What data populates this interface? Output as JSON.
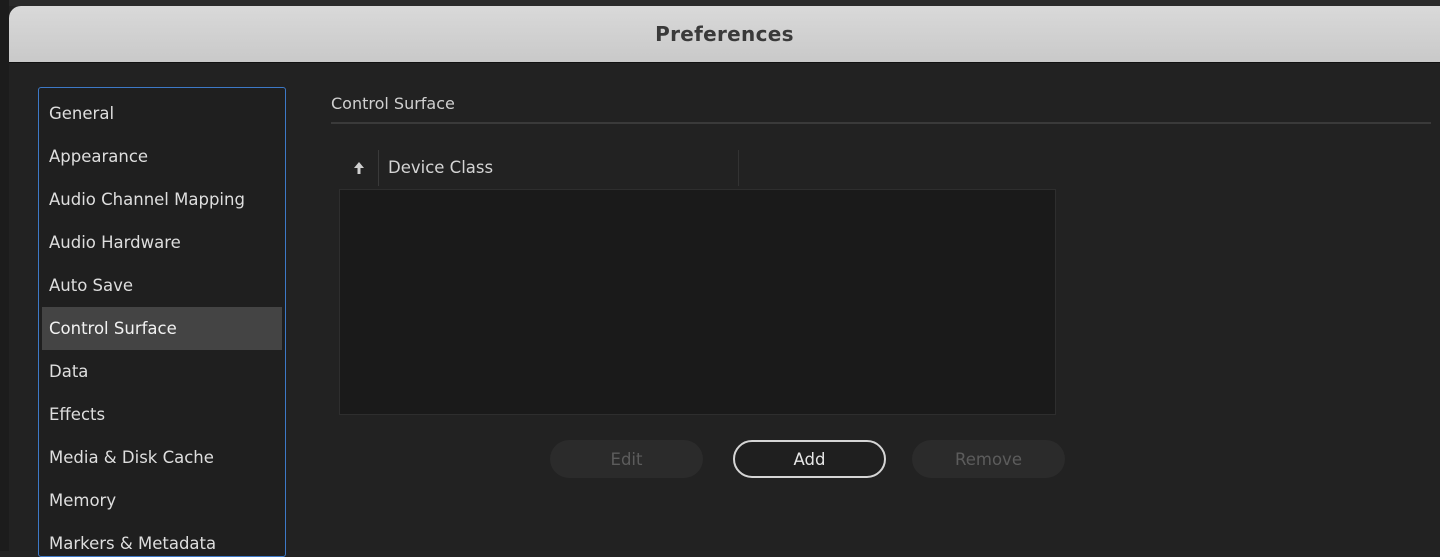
{
  "window": {
    "title": "Preferences"
  },
  "sidebar": {
    "items": [
      {
        "label": "General",
        "selected": false
      },
      {
        "label": "Appearance",
        "selected": false
      },
      {
        "label": "Audio Channel Mapping",
        "selected": false
      },
      {
        "label": "Audio Hardware",
        "selected": false
      },
      {
        "label": "Auto Save",
        "selected": false
      },
      {
        "label": "Control Surface",
        "selected": true
      },
      {
        "label": "Data",
        "selected": false
      },
      {
        "label": "Effects",
        "selected": false
      },
      {
        "label": "Media & Disk Cache",
        "selected": false
      },
      {
        "label": "Memory",
        "selected": false
      },
      {
        "label": "Markers & Metadata",
        "selected": false
      }
    ]
  },
  "panel": {
    "section_title": "Control Surface",
    "table": {
      "sort_icon": "arrow-up-icon",
      "column_header": "Device Class",
      "rows": []
    },
    "buttons": {
      "edit": {
        "label": "Edit",
        "enabled": false
      },
      "add": {
        "label": "Add",
        "enabled": true
      },
      "remove": {
        "label": "Remove",
        "enabled": false
      }
    }
  },
  "colors": {
    "selection": "#444444",
    "focus_border": "#3d79c7",
    "titlebar": "#d0d0d0"
  }
}
